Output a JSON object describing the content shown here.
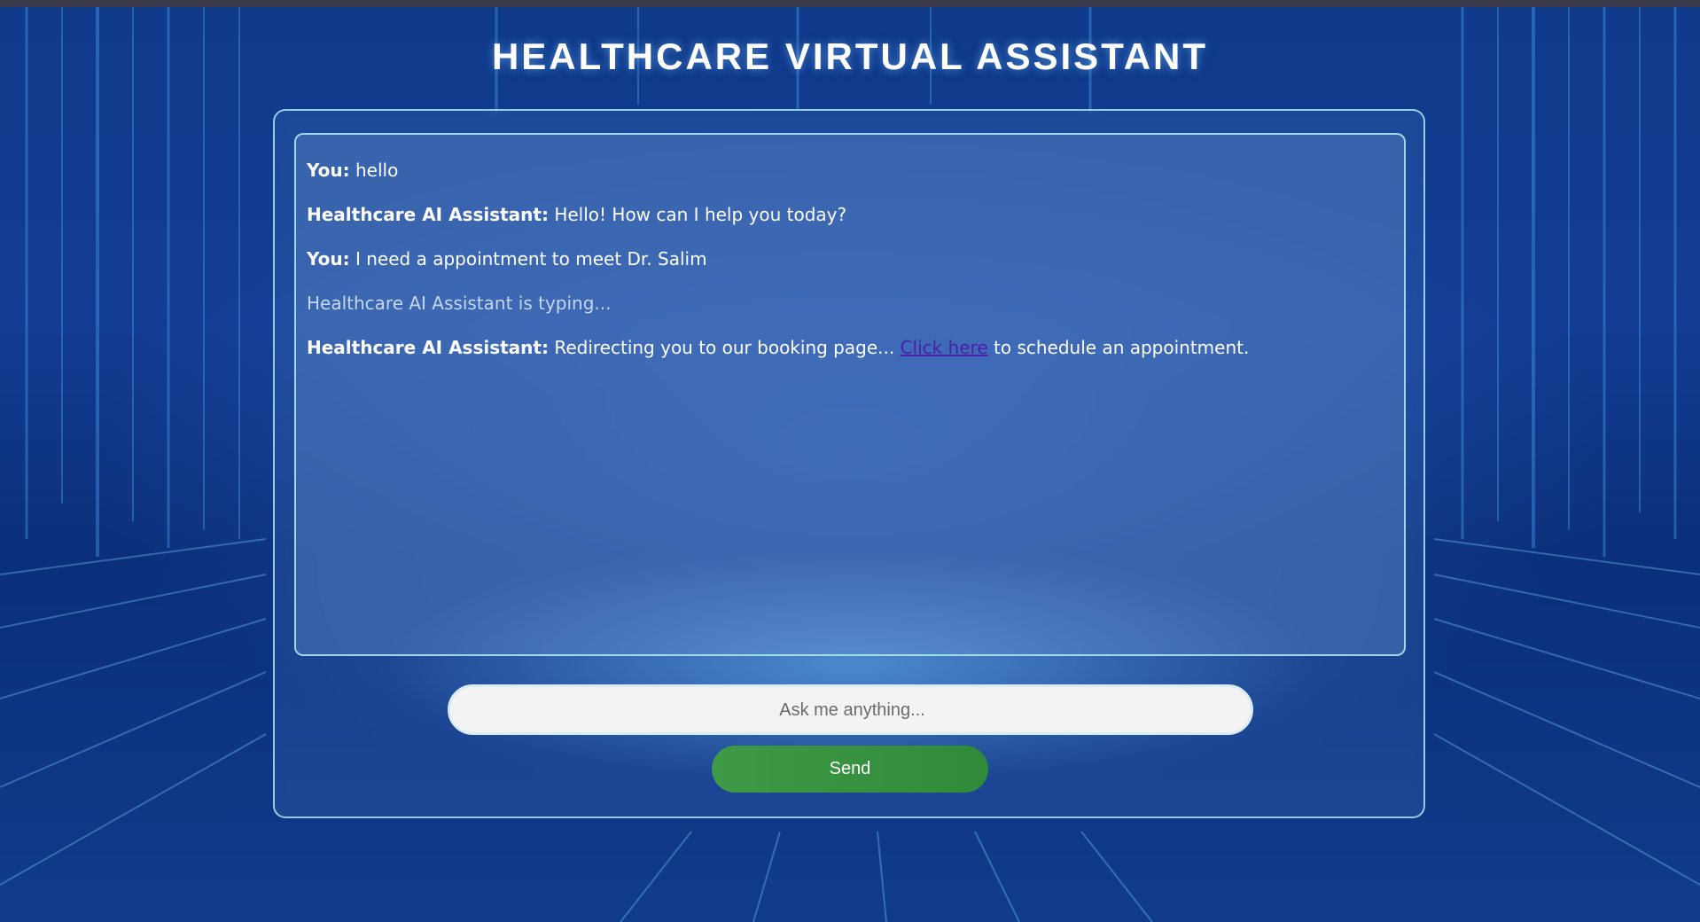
{
  "page": {
    "title": "HEALTHCARE VIRTUAL ASSISTANT"
  },
  "chat": {
    "messages": [
      {
        "sender": "You:",
        "text": " hello"
      },
      {
        "sender": "Healthcare AI Assistant:",
        "text": " Hello! How can I help you today?"
      },
      {
        "sender": "You:",
        "text": " I need a appointment to meet Dr. Salim"
      },
      {
        "typing": "Healthcare AI Assistant is typing..."
      },
      {
        "sender": "Healthcare AI Assistant:",
        "text_before": " Redirecting you to our booking page... ",
        "link_text": "Click here",
        "text_after": " to schedule an appointment."
      }
    ]
  },
  "input": {
    "placeholder": "Ask me anything...",
    "value": ""
  },
  "send_button": {
    "label": "Send"
  },
  "colors": {
    "accent_border": "#aae6f0",
    "send_button": "#3e9a46",
    "link": "#4b1fa8",
    "background": "#0f3a8a"
  }
}
